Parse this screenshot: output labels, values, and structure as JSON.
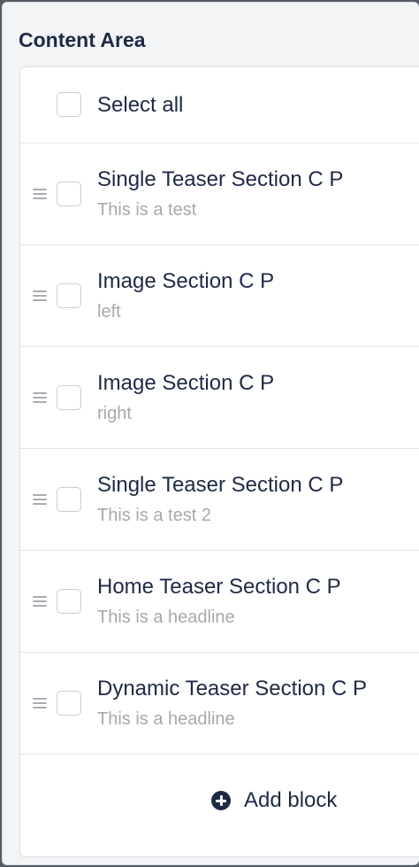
{
  "panel": {
    "title": "Content Area"
  },
  "select_all": {
    "label": "Select all"
  },
  "blocks": [
    {
      "title": "Single Teaser Section C P",
      "subtitle": "This is a test",
      "drag_icon": "drag-handle-icon"
    },
    {
      "title": "Image Section C P",
      "subtitle": "left",
      "drag_icon": "drag-handle-icon"
    },
    {
      "title": "Image Section C P",
      "subtitle": "right",
      "drag_icon": "drag-handle-icon"
    },
    {
      "title": "Single Teaser Section C P",
      "subtitle": "This is a test 2",
      "drag_icon": "drag-handle-icon"
    },
    {
      "title": "Home Teaser Section C P",
      "subtitle": "This is a headline",
      "drag_icon": "drag-handle-icon"
    },
    {
      "title": "Dynamic Teaser Section C P",
      "subtitle": "This is a headline",
      "drag_icon": "drag-handle-icon"
    }
  ],
  "add_block": {
    "label": "Add block",
    "icon": "plus-circle-icon"
  }
}
